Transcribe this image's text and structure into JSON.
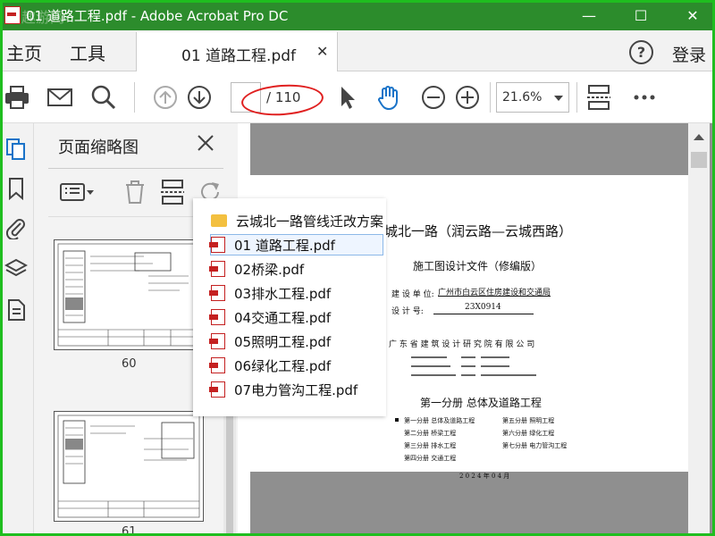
{
  "window": {
    "title": "01 道路工程.pdf - Adobe Acrobat Pro DC",
    "watermark": "趣游网",
    "minimize": "—",
    "maximize": "☐",
    "close": "✕"
  },
  "menu": {
    "home": "主页",
    "tools": "工具",
    "login": "登录",
    "help": "?"
  },
  "tab": {
    "label": "01 道路工程.pdf",
    "close": "✕"
  },
  "toolbar": {
    "page_current": "",
    "page_total": "/ 110",
    "zoom": "21.6%"
  },
  "panel": {
    "title": "页面缩略图",
    "thumbnails": [
      {
        "label": "60"
      },
      {
        "label": "61"
      }
    ]
  },
  "file_list": {
    "items": [
      {
        "name": "云城北一路管线迁改方案",
        "type": "folder"
      },
      {
        "name": "01 道路工程.pdf",
        "type": "pdf",
        "selected": true
      },
      {
        "name": "02桥梁.pdf",
        "type": "pdf"
      },
      {
        "name": "03排水工程.pdf",
        "type": "pdf"
      },
      {
        "name": "04交通工程.pdf",
        "type": "pdf"
      },
      {
        "name": "05照明工程.pdf",
        "type": "pdf"
      },
      {
        "name": "06绿化工程.pdf",
        "type": "pdf"
      },
      {
        "name": "07电力管沟工程.pdf",
        "type": "pdf"
      }
    ]
  },
  "document": {
    "title_line": "城北一路（润云路—云城西路）",
    "subtitle": "施工图设计文件（修编版）",
    "builder_label": "建 设 单 位:",
    "builder_value": "广州市白云区住房建设和交通局",
    "number_label": "设 计 号:",
    "number_value": "23X0914",
    "institute": "广 东 省 建 筑 设 计 研 究 院 有 限 公 司",
    "volume": "第一分册    总体及道路工程",
    "books_left": [
      "第一分册   总体及道路工程",
      "第二分册   桥梁工程",
      "第三分册   排水工程",
      "第四分册   交通工程"
    ],
    "books_right": [
      "第五分册   照明工程",
      "第六分册   绿化工程",
      "第七分册   电力管沟工程"
    ],
    "date": "2 0 2 4 年 0 4 月"
  },
  "colors": {
    "titlebar": "#2c8c2c",
    "frame": "#1fbe1f",
    "highlight_ellipse": "#e02020",
    "accent_blue": "#1a73c8"
  }
}
